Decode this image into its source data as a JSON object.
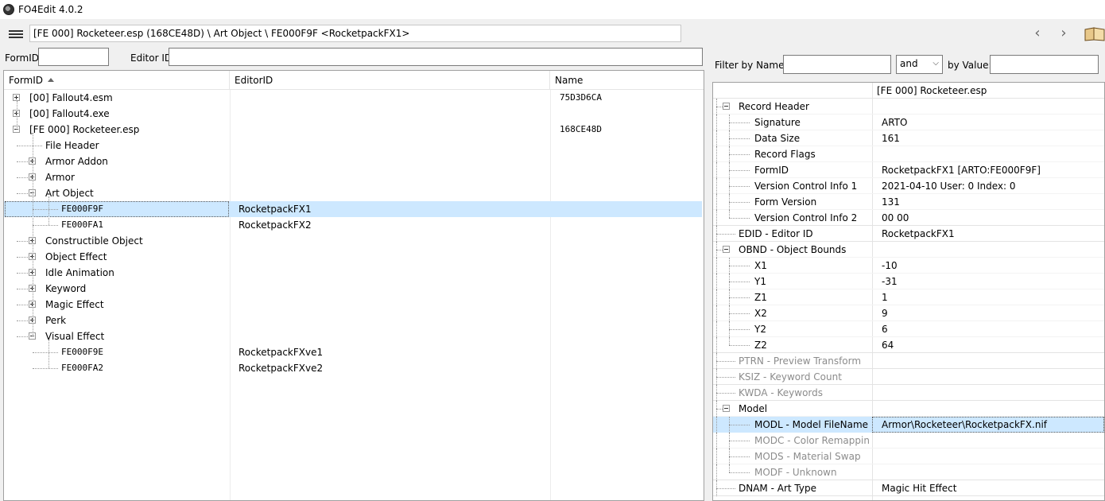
{
  "window": {
    "title": "FO4Edit 4.0.2"
  },
  "toolbar": {
    "path": "[FE 000] Rocketeer.esp (168CE48D) \\ Art Object \\ FE000F9F <RocketpackFX1>",
    "back_glyph": "‹",
    "forward_glyph": "›"
  },
  "left_filter": {
    "formid_label": "FormID",
    "editorid_label": "Editor ID",
    "formid_value": "",
    "editorid_value": ""
  },
  "tree": {
    "columns": {
      "formid": "FormID",
      "editorid": "EditorID",
      "name": "Name"
    },
    "rows": [
      {
        "label": "[00] Fallout4.esm",
        "editorid": "",
        "name": "75D3D6CA",
        "level": 0,
        "expander": "plus",
        "mono": false,
        "selected": false
      },
      {
        "label": "[00] Fallout4.exe",
        "editorid": "",
        "name": "",
        "level": 0,
        "expander": "plus",
        "mono": false,
        "selected": false
      },
      {
        "label": "[FE 000] Rocketeer.esp",
        "editorid": "",
        "name": "168CE48D",
        "level": 0,
        "expander": "minus",
        "mono": false,
        "selected": false
      },
      {
        "label": "File Header",
        "editorid": "",
        "name": "",
        "level": 1,
        "expander": "none",
        "mono": false,
        "selected": false
      },
      {
        "label": "Armor Addon",
        "editorid": "",
        "name": "",
        "level": 1,
        "expander": "plus",
        "mono": false,
        "selected": false
      },
      {
        "label": "Armor",
        "editorid": "",
        "name": "",
        "level": 1,
        "expander": "plus",
        "mono": false,
        "selected": false
      },
      {
        "label": "Art Object",
        "editorid": "",
        "name": "",
        "level": 1,
        "expander": "minus",
        "mono": false,
        "selected": false
      },
      {
        "label": "FE000F9F",
        "editorid": "RocketpackFX1",
        "name": "",
        "level": 2,
        "expander": "none",
        "mono": true,
        "selected": true
      },
      {
        "label": "FE000FA1",
        "editorid": "RocketpackFX2",
        "name": "",
        "level": 2,
        "expander": "none",
        "mono": true,
        "selected": false
      },
      {
        "label": "Constructible Object",
        "editorid": "",
        "name": "",
        "level": 1,
        "expander": "plus",
        "mono": false,
        "selected": false
      },
      {
        "label": "Object Effect",
        "editorid": "",
        "name": "",
        "level": 1,
        "expander": "plus",
        "mono": false,
        "selected": false
      },
      {
        "label": "Idle Animation",
        "editorid": "",
        "name": "",
        "level": 1,
        "expander": "plus",
        "mono": false,
        "selected": false
      },
      {
        "label": "Keyword",
        "editorid": "",
        "name": "",
        "level": 1,
        "expander": "plus",
        "mono": false,
        "selected": false
      },
      {
        "label": "Magic Effect",
        "editorid": "",
        "name": "",
        "level": 1,
        "expander": "plus",
        "mono": false,
        "selected": false
      },
      {
        "label": "Perk",
        "editorid": "",
        "name": "",
        "level": 1,
        "expander": "plus",
        "mono": false,
        "selected": false
      },
      {
        "label": "Visual Effect",
        "editorid": "",
        "name": "",
        "level": 1,
        "expander": "minus",
        "mono": false,
        "selected": false
      },
      {
        "label": "FE000F9E",
        "editorid": "RocketpackFXve1",
        "name": "",
        "level": 2,
        "expander": "none",
        "mono": true,
        "selected": false
      },
      {
        "label": "FE000FA2",
        "editorid": "RocketpackFXve2",
        "name": "",
        "level": 2,
        "expander": "none",
        "mono": true,
        "selected": false
      }
    ]
  },
  "right_filter": {
    "name_label": "Filter by Name:",
    "op_value": "and",
    "value_label": "by Value:",
    "name_value": "",
    "value_value": ""
  },
  "record": {
    "header_value": "[FE 000] Rocketeer.esp",
    "rows": [
      {
        "name": "Record Header",
        "value": "",
        "level": 0,
        "expander": "minus",
        "grey": false,
        "selected": false
      },
      {
        "name": "Signature",
        "value": "ARTO",
        "level": 1,
        "expander": "none",
        "grey": false,
        "selected": false
      },
      {
        "name": "Data Size",
        "value": "161",
        "level": 1,
        "expander": "none",
        "grey": false,
        "selected": false
      },
      {
        "name": "Record Flags",
        "value": "",
        "level": 1,
        "expander": "none",
        "grey": false,
        "selected": false
      },
      {
        "name": "FormID",
        "value": "RocketpackFX1 [ARTO:FE000F9F]",
        "level": 1,
        "expander": "none",
        "grey": false,
        "selected": false
      },
      {
        "name": "Version Control Info 1",
        "value": "2021-04-10 User: 0 Index: 0",
        "level": 1,
        "expander": "none",
        "grey": false,
        "selected": false
      },
      {
        "name": "Form Version",
        "value": "131",
        "level": 1,
        "expander": "none",
        "grey": false,
        "selected": false
      },
      {
        "name": "Version Control Info 2",
        "value": "00 00",
        "level": 1,
        "expander": "none",
        "grey": false,
        "selected": false
      },
      {
        "name": "EDID - Editor ID",
        "value": "RocketpackFX1",
        "level": 0,
        "expander": "none",
        "grey": false,
        "selected": false
      },
      {
        "name": "OBND - Object Bounds",
        "value": "",
        "level": 0,
        "expander": "minus",
        "grey": false,
        "selected": false
      },
      {
        "name": "X1",
        "value": "-10",
        "level": 1,
        "expander": "none",
        "grey": false,
        "selected": false
      },
      {
        "name": "Y1",
        "value": "-31",
        "level": 1,
        "expander": "none",
        "grey": false,
        "selected": false
      },
      {
        "name": "Z1",
        "value": "1",
        "level": 1,
        "expander": "none",
        "grey": false,
        "selected": false
      },
      {
        "name": "X2",
        "value": "9",
        "level": 1,
        "expander": "none",
        "grey": false,
        "selected": false
      },
      {
        "name": "Y2",
        "value": "6",
        "level": 1,
        "expander": "none",
        "grey": false,
        "selected": false
      },
      {
        "name": "Z2",
        "value": "64",
        "level": 1,
        "expander": "none",
        "grey": false,
        "selected": false
      },
      {
        "name": "PTRN - Preview Transform",
        "value": "",
        "level": 0,
        "expander": "none",
        "grey": true,
        "selected": false
      },
      {
        "name": "KSIZ - Keyword Count",
        "value": "",
        "level": 0,
        "expander": "none",
        "grey": true,
        "selected": false
      },
      {
        "name": "KWDA - Keywords",
        "value": "",
        "level": 0,
        "expander": "none",
        "grey": true,
        "selected": false
      },
      {
        "name": "Model",
        "value": "",
        "level": 0,
        "expander": "minus",
        "grey": false,
        "selected": false
      },
      {
        "name": "MODL - Model FileName",
        "value": "Armor\\Rocketeer\\RocketpackFX.nif",
        "level": 1,
        "expander": "none",
        "grey": false,
        "selected": true
      },
      {
        "name": "MODC - Color Remappin...",
        "value": "",
        "level": 1,
        "expander": "none",
        "grey": true,
        "selected": false
      },
      {
        "name": "MODS - Material Swap",
        "value": "",
        "level": 1,
        "expander": "none",
        "grey": true,
        "selected": false
      },
      {
        "name": "MODF - Unknown",
        "value": "",
        "level": 1,
        "expander": "none",
        "grey": true,
        "selected": false
      },
      {
        "name": "DNAM - Art Type",
        "value": "Magic Hit Effect",
        "level": 0,
        "expander": "none",
        "grey": false,
        "selected": false
      }
    ]
  },
  "colors": {
    "selection": "#cde8ff",
    "panel": "#f0f0f0",
    "grey_text": "#8c8c8c"
  }
}
